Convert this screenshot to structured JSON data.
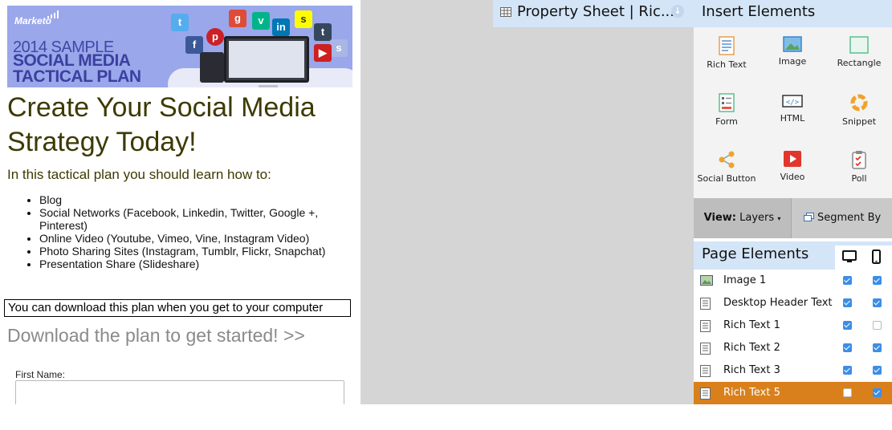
{
  "canvas": {
    "banner": {
      "brand": "Marketo",
      "line1": "2014 SAMPLE",
      "line2": "SOCIAL MEDIA",
      "line3": "TACTICAL PLAN"
    },
    "headline": "Create Your Social Media Strategy Today!",
    "intro": "In this tactical plan you should learn how to:",
    "bullets": [
      "Blog",
      "Social Networks (Facebook, Linkedin, Twitter, Google +, Pinterest)",
      "Online Video (Youtube, Vimeo, Vine, Instagram Video)",
      "Photo Sharing Sites (Instagram, Tumblr, Flickr, Snapchat)",
      "Presentation Share (Slideshare)"
    ],
    "notice": "You can download this plan when you get to your computer",
    "cta": "Download the plan to get started! >>",
    "form": {
      "first_name_label": "First Name:",
      "first_name_value": ""
    }
  },
  "property_tab": {
    "title": "Property Sheet | Ric..."
  },
  "insert": {
    "header": "Insert Elements",
    "items": [
      {
        "label": "Rich Text",
        "icon": "rich-text-icon"
      },
      {
        "label": "Image",
        "icon": "image-icon"
      },
      {
        "label": "Rectangle",
        "icon": "rectangle-icon"
      },
      {
        "label": "Form",
        "icon": "form-icon"
      },
      {
        "label": "HTML",
        "icon": "html-icon"
      },
      {
        "label": "Snippet",
        "icon": "snippet-icon"
      },
      {
        "label": "Social Button",
        "icon": "social-button-icon"
      },
      {
        "label": "Video",
        "icon": "video-icon"
      },
      {
        "label": "Poll",
        "icon": "poll-icon"
      }
    ]
  },
  "view_bar": {
    "view_label": "View:",
    "view_value": "Layers",
    "segment_label": "Segment By"
  },
  "page_elements": {
    "header": "Page Elements",
    "rows": [
      {
        "name": "Image 1",
        "desktop": true,
        "mobile": true,
        "selected": false
      },
      {
        "name": "Desktop Header Text",
        "desktop": true,
        "mobile": true,
        "selected": false
      },
      {
        "name": "Rich Text 1",
        "desktop": true,
        "mobile": false,
        "selected": false
      },
      {
        "name": "Rich Text 2",
        "desktop": true,
        "mobile": true,
        "selected": false
      },
      {
        "name": "Rich Text 3",
        "desktop": true,
        "mobile": true,
        "selected": false
      },
      {
        "name": "Rich Text 5",
        "desktop": false,
        "mobile": true,
        "selected": true
      }
    ]
  },
  "colors": {
    "headline": "#3d3a00",
    "panel_blue": "#d3e5f7",
    "selected_row": "#d9801c",
    "checkbox_on": "#3c8ee6",
    "workspace_gray": "#d5d5d5"
  }
}
